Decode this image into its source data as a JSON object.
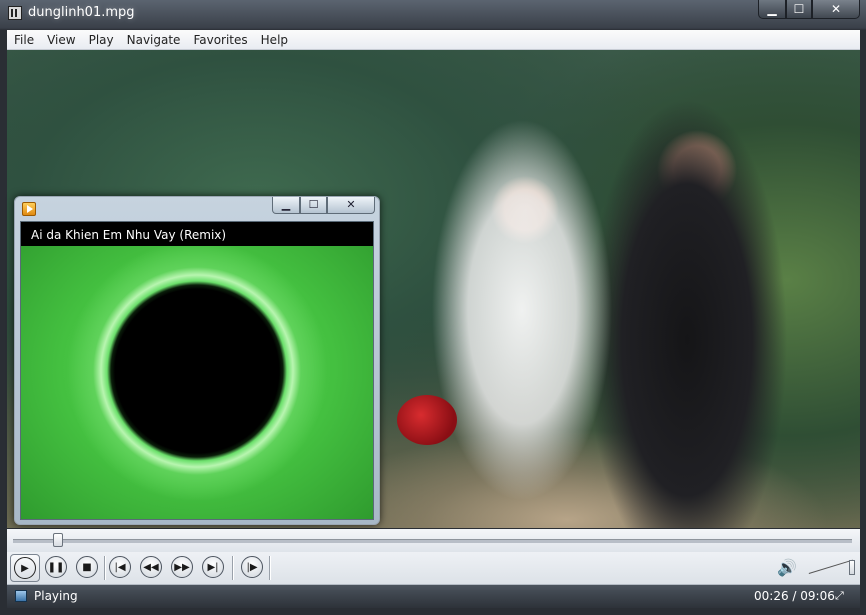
{
  "window": {
    "title": "dunglinh01.mpg",
    "controls": {
      "minimize": "▁",
      "maximize": "☐",
      "close": "✕"
    }
  },
  "menu": [
    "File",
    "View",
    "Play",
    "Navigate",
    "Favorites",
    "Help"
  ],
  "visualization": {
    "track_title": "Ai da Khien Em Nhu Vay (Remix)",
    "controls": {
      "minimize": "▁",
      "maximize": "☐",
      "close": "✕"
    }
  },
  "playback": {
    "buttons": [
      "play",
      "pause",
      "stop",
      "skip-back",
      "rewind",
      "fast-forward",
      "skip-next",
      "frame-step"
    ],
    "seek_fraction": 0.048
  },
  "status": {
    "state": "Playing",
    "time": "00:26 / 09:06"
  },
  "volume": {
    "level": 1.0
  },
  "colors": {
    "visualizer_green": "#4cc847",
    "accent_volume": "#3a9a3a"
  }
}
